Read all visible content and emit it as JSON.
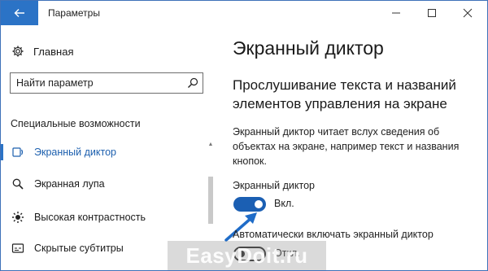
{
  "window": {
    "title": "Параметры"
  },
  "sidebar": {
    "home_label": "Главная",
    "search_value": "Найти параметр",
    "section_heading": "Специальные возможности",
    "items": [
      {
        "label": "Экранный диктор",
        "icon": "narrator-icon",
        "active": true
      },
      {
        "label": "Экранная лупа",
        "icon": "magnifier-icon",
        "active": false
      },
      {
        "label": "Высокая контрастность",
        "icon": "contrast-icon",
        "active": false
      },
      {
        "label": "Скрытые субтитры",
        "icon": "captions-icon",
        "active": false
      }
    ]
  },
  "content": {
    "title": "Экранный диктор",
    "section_title": "Прослушивание текста и названий элементов управления на экране",
    "description": "Экранный диктор читает вслух сведения об объектах на экране, например текст и названия кнопок.",
    "narrator_label": "Экранный диктор",
    "narrator_state": "Вкл.",
    "auto_label": "Автоматически включать экранный диктор",
    "auto_state": "Откл."
  },
  "watermark": "EasyDoit.ru",
  "colors": {
    "accent": "#2b73c6",
    "toggle_on": "#1b5fb3",
    "active_text": "#1c5fae",
    "annotation_arrow": "#1f6cc8"
  }
}
